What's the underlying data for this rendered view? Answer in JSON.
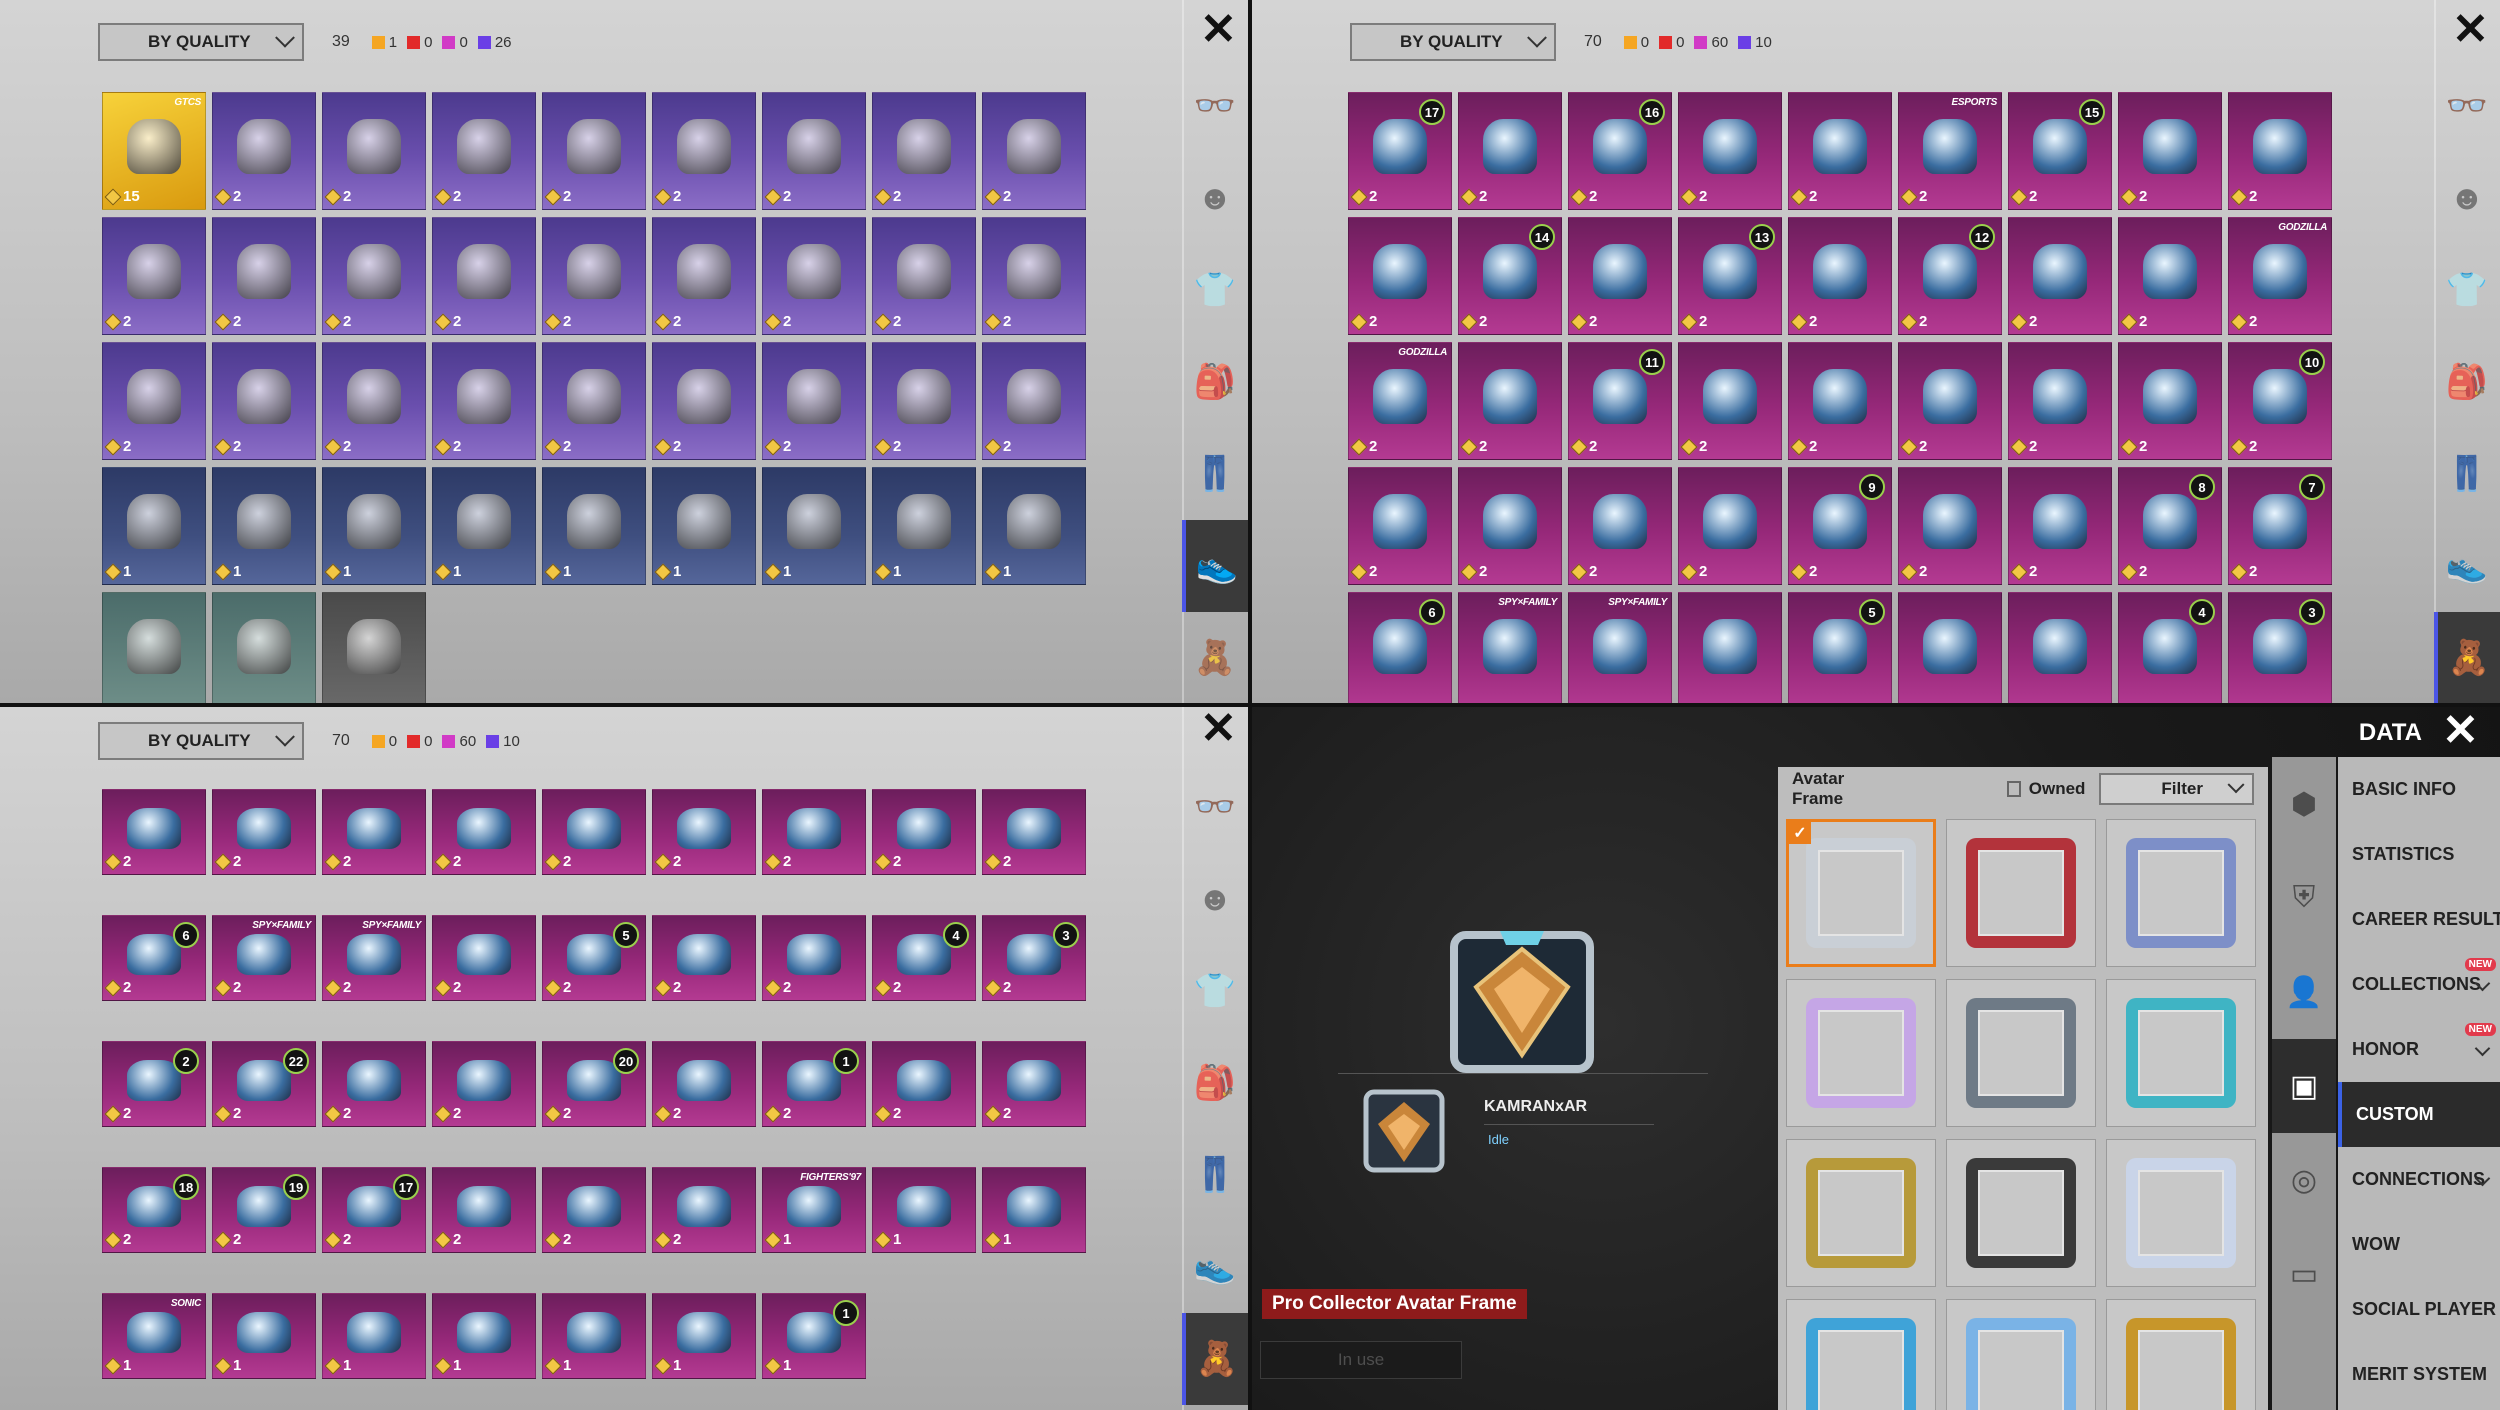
{
  "colors": {
    "legendary": "#f5c23a",
    "mythic_red": "#e22a2a",
    "epic_pink": "#d13ac6",
    "purple": "#6a3fe6",
    "accent_blue": "#4b55e6",
    "selected_orange": "#ea7d1a"
  },
  "panels": [
    {
      "sort": "BY QUALITY",
      "count": "39",
      "legend": [
        "1",
        "0",
        "0",
        "26"
      ],
      "active_category": 5
    },
    {
      "sort": "BY QUALITY",
      "count": "70",
      "legend": [
        "0",
        "0",
        "60",
        "10"
      ],
      "active_category": 6
    },
    {
      "sort": "BY QUALITY",
      "count": "70",
      "legend": [
        "0",
        "0",
        "60",
        "10"
      ],
      "active_category": 6
    }
  ],
  "close_glyph": "✕",
  "category_icons": [
    "glasses-icon",
    "mask-icon",
    "jacket-icon",
    "backpack-icon",
    "pants-icon",
    "shoes-icon",
    "charm-icon"
  ],
  "shoes_items": [
    {
      "q": "legend",
      "n": "15",
      "tag": "GTCS"
    },
    {
      "q": "epic",
      "n": "2"
    },
    {
      "q": "epic",
      "n": "2"
    },
    {
      "q": "epic",
      "n": "2"
    },
    {
      "q": "epic",
      "n": "2"
    },
    {
      "q": "epic",
      "n": "2"
    },
    {
      "q": "epic",
      "n": "2"
    },
    {
      "q": "epic",
      "n": "2"
    },
    {
      "q": "epic",
      "n": "2"
    },
    {
      "q": "epic",
      "n": "2"
    },
    {
      "q": "epic",
      "n": "2"
    },
    {
      "q": "epic",
      "n": "2"
    },
    {
      "q": "epic",
      "n": "2"
    },
    {
      "q": "epic",
      "n": "2"
    },
    {
      "q": "epic",
      "n": "2"
    },
    {
      "q": "epic",
      "n": "2"
    },
    {
      "q": "epic",
      "n": "2"
    },
    {
      "q": "epic",
      "n": "2"
    },
    {
      "q": "epic",
      "n": "2"
    },
    {
      "q": "epic",
      "n": "2"
    },
    {
      "q": "epic",
      "n": "2"
    },
    {
      "q": "epic",
      "n": "2"
    },
    {
      "q": "epic",
      "n": "2"
    },
    {
      "q": "epic",
      "n": "2"
    },
    {
      "q": "epic",
      "n": "2"
    },
    {
      "q": "epic",
      "n": "2"
    },
    {
      "q": "epic",
      "n": "2"
    },
    {
      "q": "rare",
      "n": "1"
    },
    {
      "q": "rare",
      "n": "1"
    },
    {
      "q": "rare",
      "n": "1"
    },
    {
      "q": "rare",
      "n": "1"
    },
    {
      "q": "rare",
      "n": "1"
    },
    {
      "q": "rare",
      "n": "1"
    },
    {
      "q": "rare",
      "n": "1"
    },
    {
      "q": "rare",
      "n": "1"
    },
    {
      "q": "rare",
      "n": "1"
    },
    {
      "q": "green",
      "n": ""
    },
    {
      "q": "green",
      "n": ""
    },
    {
      "q": "grey",
      "n": ""
    }
  ],
  "charms_top": [
    {
      "n": "2",
      "lvl": "17"
    },
    {
      "n": "2"
    },
    {
      "n": "2",
      "lvl": "16"
    },
    {
      "n": "2"
    },
    {
      "n": "2"
    },
    {
      "n": "2",
      "tag": "ESPORTS"
    },
    {
      "n": "2",
      "lvl": "15"
    },
    {
      "n": "2"
    },
    {
      "n": "2"
    },
    {
      "n": "2"
    },
    {
      "n": "2",
      "lvl": "14"
    },
    {
      "n": "2"
    },
    {
      "n": "2",
      "lvl": "13"
    },
    {
      "n": "2"
    },
    {
      "n": "2",
      "lvl": "12"
    },
    {
      "n": "2"
    },
    {
      "n": "2"
    },
    {
      "n": "2",
      "tag": "GODZILLA"
    },
    {
      "n": "2",
      "tag": "GODZILLA"
    },
    {
      "n": "2"
    },
    {
      "n": "2",
      "lvl": "11"
    },
    {
      "n": "2"
    },
    {
      "n": "2"
    },
    {
      "n": "2"
    },
    {
      "n": "2"
    },
    {
      "n": "2"
    },
    {
      "n": "2",
      "lvl": "10"
    },
    {
      "n": "2"
    },
    {
      "n": "2"
    },
    {
      "n": "2"
    },
    {
      "n": "2"
    },
    {
      "n": "2",
      "lvl": "9"
    },
    {
      "n": "2"
    },
    {
      "n": "2"
    },
    {
      "n": "2",
      "lvl": "8"
    },
    {
      "n": "2",
      "lvl": "7"
    },
    {
      "n": "",
      "lvl": "6"
    },
    {
      "n": "",
      "tag": "SPY×FAMILY"
    },
    {
      "n": "",
      "tag": "SPY×FAMILY"
    },
    {
      "n": ""
    },
    {
      "n": "",
      "lvl": "5"
    },
    {
      "n": ""
    },
    {
      "n": ""
    },
    {
      "n": "",
      "lvl": "4"
    },
    {
      "n": "",
      "lvl": "3"
    }
  ],
  "charms_bottom": [
    {
      "n": "2"
    },
    {
      "n": "2"
    },
    {
      "n": "2"
    },
    {
      "n": "2"
    },
    {
      "n": "2"
    },
    {
      "n": "2"
    },
    {
      "n": "2"
    },
    {
      "n": "2"
    },
    {
      "n": "2"
    },
    {
      "n": "2",
      "lvl": "6"
    },
    {
      "n": "2",
      "tag": "SPY×FAMILY"
    },
    {
      "n": "2",
      "tag": "SPY×FAMILY"
    },
    {
      "n": "2"
    },
    {
      "n": "2",
      "lvl": "5"
    },
    {
      "n": "2"
    },
    {
      "n": "2"
    },
    {
      "n": "2",
      "lvl": "4"
    },
    {
      "n": "2",
      "lvl": "3"
    },
    {
      "n": "2",
      "lvl": "2"
    },
    {
      "n": "2",
      "lvl": "22"
    },
    {
      "n": "2"
    },
    {
      "n": "2"
    },
    {
      "n": "2",
      "lvl": "20"
    },
    {
      "n": "2"
    },
    {
      "n": "2",
      "lvl": "1"
    },
    {
      "n": "2"
    },
    {
      "n": "2"
    },
    {
      "n": "2",
      "lvl": "18"
    },
    {
      "n": "2",
      "lvl": "19"
    },
    {
      "n": "2",
      "lvl": "17"
    },
    {
      "n": "2"
    },
    {
      "n": "2"
    },
    {
      "n": "2"
    },
    {
      "n": "1",
      "tag": "FIGHTERS'97"
    },
    {
      "n": "1"
    },
    {
      "n": "1"
    },
    {
      "n": "1",
      "tag": "SONIC"
    },
    {
      "n": "1"
    },
    {
      "n": "1"
    },
    {
      "n": "1"
    },
    {
      "n": "1"
    },
    {
      "n": "1"
    },
    {
      "n": "1",
      "lvl": "1"
    }
  ],
  "data_screen": {
    "title": "DATA",
    "player_name": "KAMRANxAR",
    "status": "Idle",
    "frame_name": "Pro Collector Avatar Frame",
    "in_use": "In use",
    "panel_title": "Avatar Frame",
    "owned_label": "Owned",
    "filter_label": "Filter",
    "frame_colors": [
      "#c9cfd6",
      "#b3333b",
      "#7d8fc8",
      "#c5a6e6",
      "#6e7a86",
      "#3fb4c4",
      "#b79a3a",
      "#3a3a3a",
      "#c9d4e8",
      "#3fa3d8",
      "#7ab3e6",
      "#c7962a"
    ],
    "side_tabs": [
      "hexagon-icon",
      "shield-icon",
      "person-icon",
      "frame-icon",
      "goggles-icon",
      "ticket-icon"
    ],
    "menu": [
      {
        "label": "BASIC INFO"
      },
      {
        "label": "STATISTICS"
      },
      {
        "label": "CAREER RESULTS"
      },
      {
        "label": "COLLECTIONS",
        "new": "NEW",
        "chev": true
      },
      {
        "label": "HONOR",
        "new": "NEW",
        "chev": true
      },
      {
        "label": "CUSTOM",
        "active": true
      },
      {
        "label": "CONNECTIONS",
        "chev": true
      },
      {
        "label": "WOW"
      },
      {
        "label": "SOCIAL PLAYER CAR"
      },
      {
        "label": "MERIT SYSTEM"
      }
    ]
  }
}
